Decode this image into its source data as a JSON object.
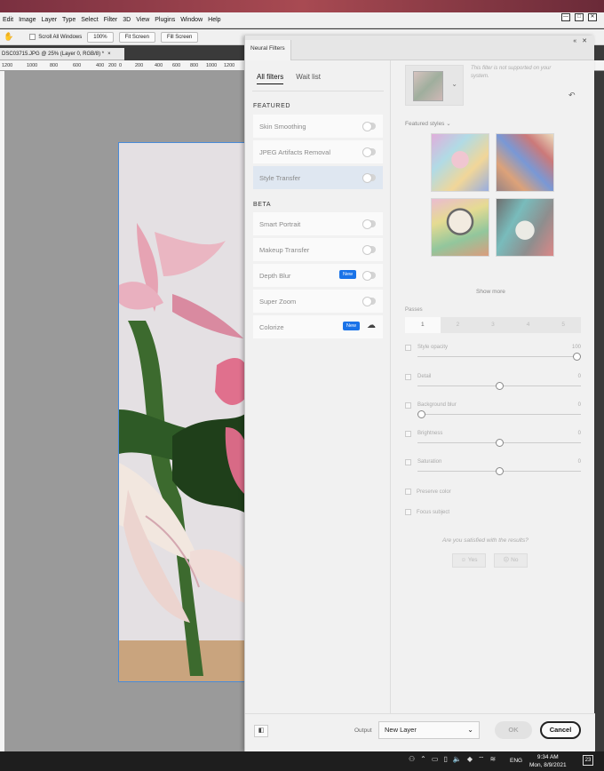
{
  "menu": [
    "Edit",
    "Image",
    "Layer",
    "Type",
    "Select",
    "Filter",
    "3D",
    "View",
    "Plugins",
    "Window",
    "Help"
  ],
  "window_controls": [
    "—",
    "□",
    "✕"
  ],
  "options_bar": {
    "scroll_all": "Scroll All Windows",
    "zoom": "100%",
    "fit": "Fit Screen",
    "fill": "Fill Screen"
  },
  "doc_tab": {
    "title": "DSC03715.JPG @ 25% (Layer 0, RGB/8) *",
    "close": "×"
  },
  "ruler_ticks": [
    "1200",
    "1000",
    "800",
    "600",
    "400",
    "200",
    "0",
    "200",
    "400",
    "600",
    "800",
    "1000",
    "1200"
  ],
  "panel": {
    "title": "Neural Filters",
    "header_controls": "«  ✕",
    "tabs": {
      "all": "All filters",
      "wait": "Wait list"
    },
    "featured_label": "FEATURED",
    "beta_label": "BETA",
    "featured": [
      {
        "label": "Skin Smoothing"
      },
      {
        "label": "JPEG Artifacts Removal"
      },
      {
        "label": "Style Transfer"
      }
    ],
    "beta": [
      {
        "label": "Smart Portrait"
      },
      {
        "label": "Makeup Transfer"
      },
      {
        "label": "Depth Blur",
        "badge": "New"
      },
      {
        "label": "Super Zoom"
      },
      {
        "label": "Colorize",
        "badge": "New"
      }
    ],
    "not_supported": "This filter is not supported on your system.",
    "featured_styles": "Featured styles ⌄",
    "show_more": "Show more",
    "passes_label": "Passes",
    "passes": [
      "1",
      "2",
      "3",
      "4",
      "5"
    ],
    "params": [
      {
        "label": "Style opacity",
        "value": "100",
        "level": 1.0
      },
      {
        "label": "Detail",
        "value": "0",
        "level": 0.5
      },
      {
        "label": "Background blur",
        "value": "0",
        "level": 0.0
      },
      {
        "label": "Brightness",
        "value": "0",
        "level": 0.5
      },
      {
        "label": "Saturation",
        "value": "0",
        "level": 0.5
      }
    ],
    "preserve_color": "Preserve color",
    "focus_subject": "Focus subject",
    "satisfied_q": "Are you satisfied with the results?",
    "yes": "☺ Yes",
    "no": "☹ No",
    "output_label": "Output",
    "output_value": "New Layer",
    "ok": "OK",
    "cancel": "Cancel"
  },
  "taskbar": {
    "lang": "ENG",
    "time": "9:34 AM",
    "date": "Mon, 8/9/2021",
    "notif": "23"
  }
}
